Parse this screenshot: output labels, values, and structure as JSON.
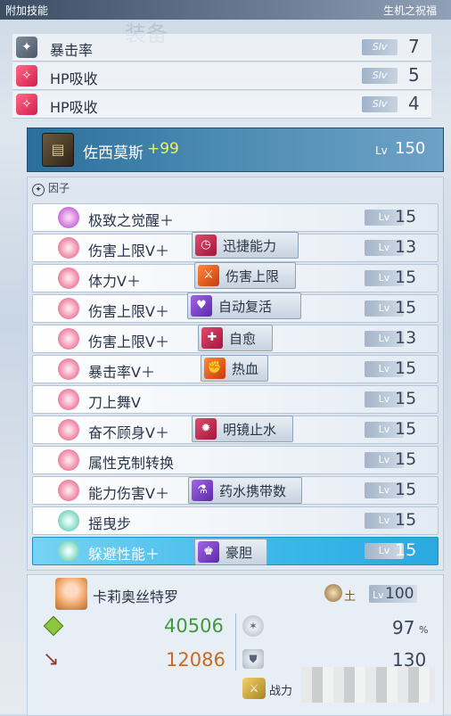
{
  "header": {
    "left_title": "附加技能",
    "right_title": "生机之祝福"
  },
  "watermark": "装备",
  "bonus_skills": [
    {
      "name": "暴击率",
      "slv_label": "Slv",
      "level": "7",
      "icon": "crit-icon",
      "color": "#4c5866"
    },
    {
      "name": "HP吸收",
      "slv_label": "Slv",
      "level": "5",
      "icon": "hp-drain-icon",
      "color": "#d21e4c"
    },
    {
      "name": "HP吸收",
      "slv_label": "Slv",
      "level": "4",
      "icon": "hp-drain-icon",
      "color": "#d21e4c"
    }
  ],
  "weapon": {
    "name": "佐西莫斯",
    "plus": "+99",
    "lv_label": "Lv",
    "level": "150",
    "icon": "grimoire-icon"
  },
  "factor_section_title": "因子",
  "factors": [
    {
      "name": "极致之觉醒＋",
      "lv_label": "Lv",
      "level": "15",
      "icon": "awakening-factor-icon"
    },
    {
      "name": "伤害上限Ⅴ＋",
      "lv_label": "Lv",
      "level": "13",
      "tag": "迅捷能力",
      "tag_icon": "clock-icon"
    },
    {
      "name": "体力Ⅴ＋",
      "lv_label": "Lv",
      "level": "15",
      "tag": "伤害上限",
      "tag_icon": "sword-icon"
    },
    {
      "name": "伤害上限Ⅴ＋",
      "lv_label": "Lv",
      "level": "15",
      "tag": "自动复活",
      "tag_icon": "revive-icon"
    },
    {
      "name": "伤害上限Ⅴ＋",
      "lv_label": "Lv",
      "level": "13",
      "tag": "自愈",
      "tag_icon": "heal-icon"
    },
    {
      "name": "暴击率Ⅴ＋",
      "lv_label": "Lv",
      "level": "15",
      "tag": "热血",
      "tag_icon": "muscle-icon"
    },
    {
      "name": "刀上舞Ⅴ",
      "lv_label": "Lv",
      "level": "15"
    },
    {
      "name": "奋不顾身Ⅴ＋",
      "lv_label": "Lv",
      "level": "15",
      "tag": "明镜止水",
      "tag_icon": "mirror-icon"
    },
    {
      "name": "属性克制转换",
      "lv_label": "Lv",
      "level": "15"
    },
    {
      "name": "能力伤害Ⅴ＋",
      "lv_label": "Lv",
      "level": "15",
      "tag": "药水携带数",
      "tag_icon": "potion-icon"
    },
    {
      "name": "摇曳步",
      "lv_label": "Lv",
      "level": "15"
    },
    {
      "name": "躲避性能＋",
      "lv_label": "Lv",
      "level": "15",
      "tag": "豪胆",
      "tag_icon": "courage-icon",
      "selected": true
    }
  ],
  "character": {
    "name": "卡莉奥丝特罗",
    "element": "土",
    "lv_label": "Lv",
    "level": "100",
    "hp": "40506",
    "attack": "12086",
    "crit": "97",
    "crit_unit": "%",
    "defense": "130",
    "power_label": "战力"
  }
}
